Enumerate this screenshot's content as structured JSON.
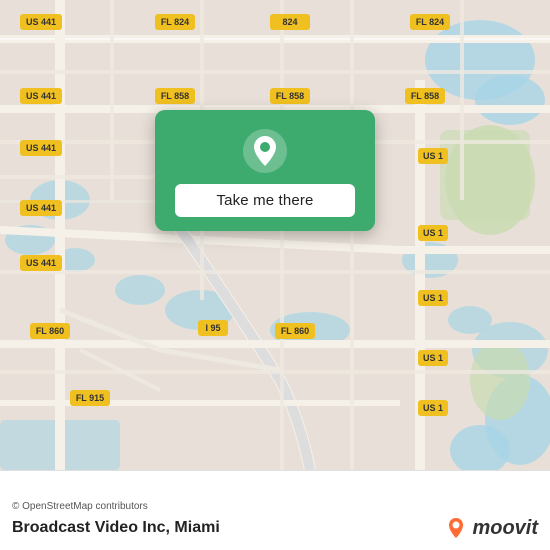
{
  "map": {
    "background_color": "#e8e0d8",
    "alt": "Street map of Miami area"
  },
  "popup": {
    "button_label": "Take me there",
    "background_color": "#3daa6e",
    "pin_icon": "location-pin"
  },
  "bottom_bar": {
    "attribution": "© OpenStreetMap contributors",
    "location_name": "Broadcast Video Inc, Miami",
    "moovit_logo_text": "moovit"
  }
}
